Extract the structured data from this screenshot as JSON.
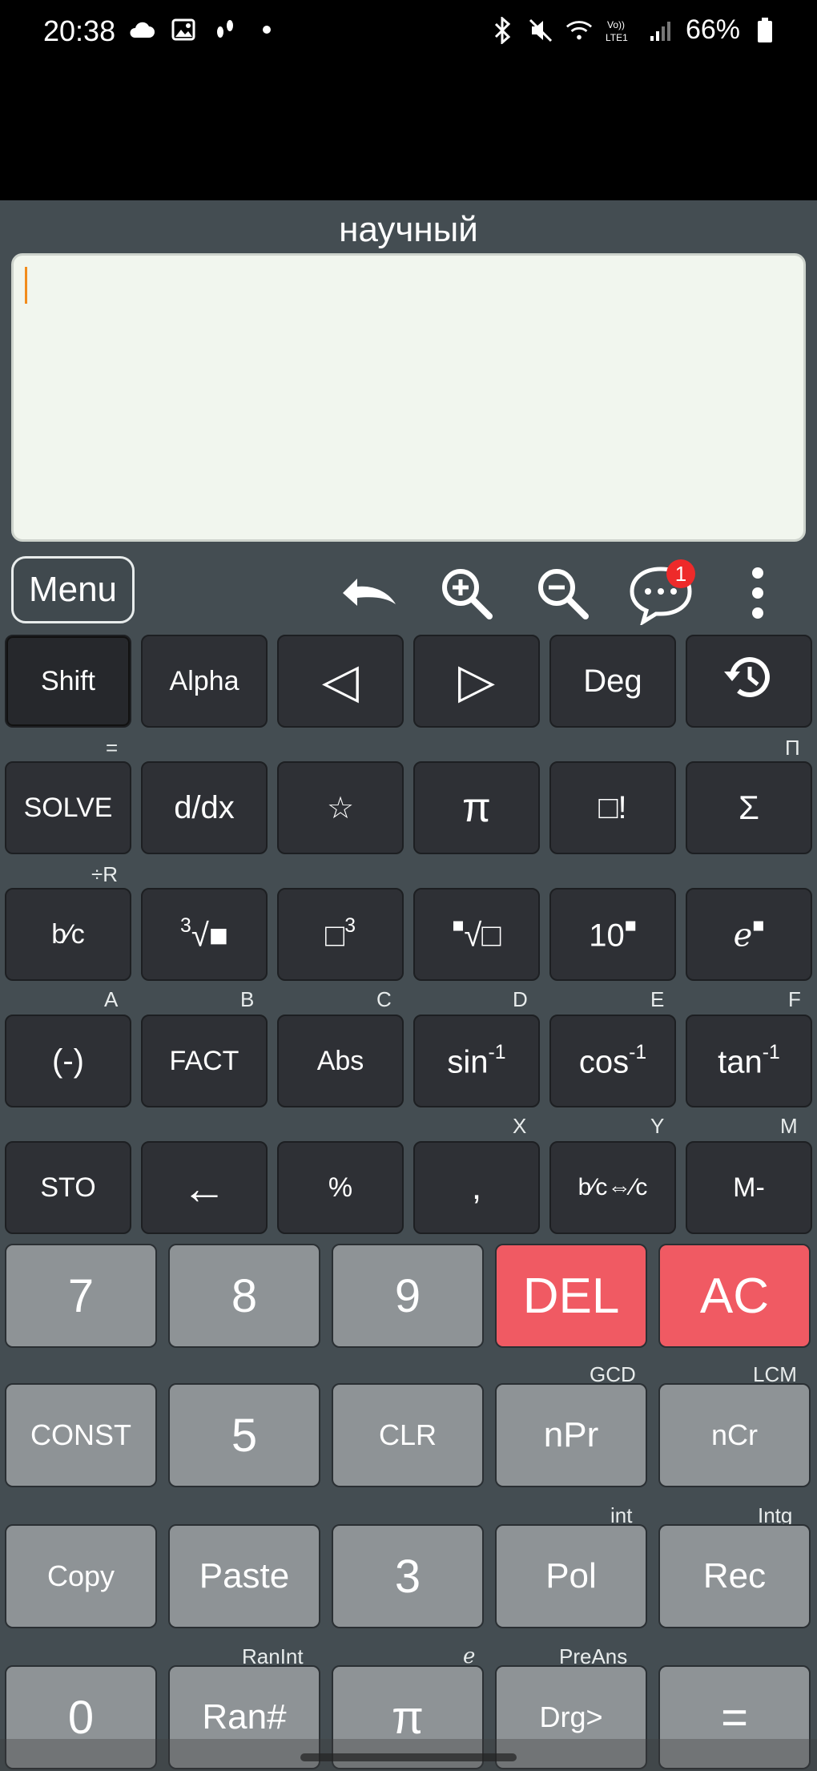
{
  "status": {
    "time": "20:38",
    "battery": "66%",
    "network": "LTE1"
  },
  "app": {
    "mode_title": "научный",
    "menu_label": "Menu",
    "badge_count": "1"
  },
  "rows": {
    "row1": [
      "Shift",
      "Alpha",
      "◁",
      "▷",
      "Deg"
    ],
    "row2_labels": {
      "above_solve": "=",
      "above_sigma": "Π"
    },
    "row2": [
      "SOLVE",
      "d/dx",
      "☆",
      "π",
      "□!",
      "Σ"
    ],
    "row3_labels": {
      "above_b": "÷R"
    },
    "row3": {
      "b_frac": "b⁄c",
      "cbrt_sup": "3",
      "cbrt_text": "√■",
      "cube_base": "□",
      "cube_sup": "3",
      "xroot_sup": "■",
      "xroot_text": "√□",
      "ten_base": "10",
      "ten_sup": "■",
      "e_base": "e",
      "e_sup": "■"
    },
    "row4_labels": [
      "A",
      "B",
      "C",
      "D",
      "E",
      "F"
    ],
    "row4": {
      "neg": "(-)",
      "fact": "FACT",
      "abs": "Abs",
      "asin_base": "sin",
      "acos_base": "cos",
      "atan_base": "tan",
      "inv_sup": "-1"
    },
    "row5_labels": {
      "x": "X",
      "y": "Y",
      "m": "M"
    },
    "row5": [
      "STO",
      "←",
      "%",
      ",",
      "b⁄c⇔⁄c",
      "M-"
    ],
    "row6": [
      "7",
      "8",
      "9",
      "DEL",
      "AC"
    ],
    "row7_labels": {
      "gcd": "GCD",
      "lcm": "LCM"
    },
    "row7": [
      "CONST",
      "5",
      "CLR",
      "nPr",
      "nCr"
    ],
    "row8_labels": {
      "int": "int",
      "intg": "Intg"
    },
    "row8": [
      "Copy",
      "Paste",
      "3",
      "Pol",
      "Rec"
    ],
    "row9_labels": {
      "ranint": "RanInt",
      "e": "e",
      "preans": "PreAns"
    },
    "row9": [
      "0",
      "Ran#",
      "π",
      "Drg>",
      "="
    ]
  }
}
